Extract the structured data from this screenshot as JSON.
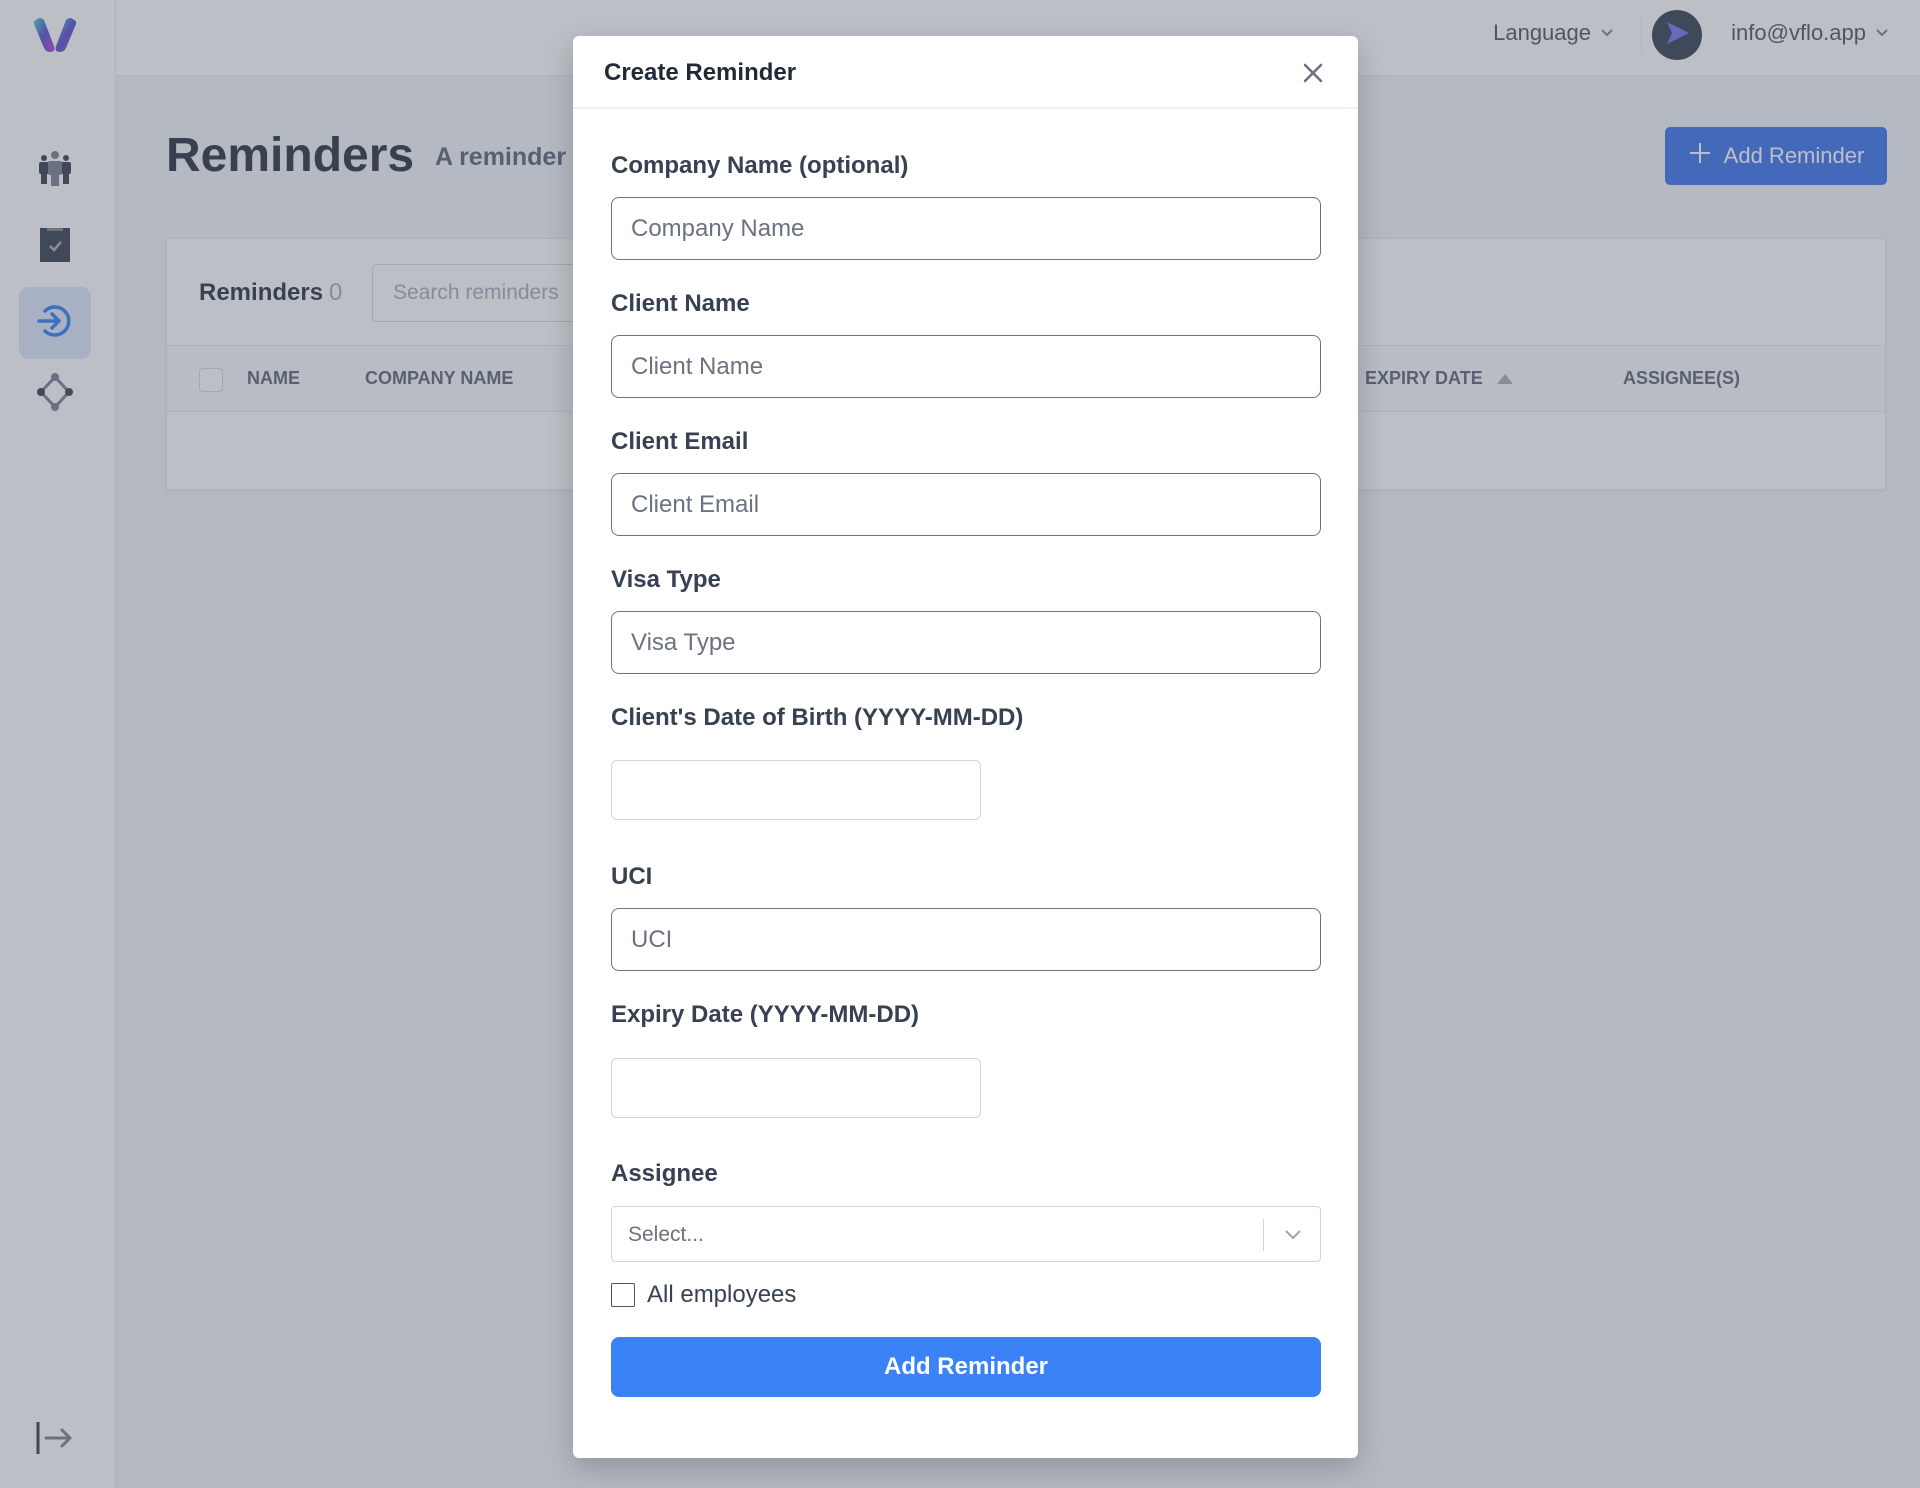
{
  "topbar": {
    "language_label": "Language",
    "user_email": "info@vflo.app"
  },
  "sidebar": {
    "items": [
      {
        "name": "team",
        "icon": "team-icon",
        "active": false
      },
      {
        "name": "tasks",
        "icon": "clipboard-check-icon",
        "active": false
      },
      {
        "name": "reminders",
        "icon": "arrow-circle-icon",
        "active": true
      },
      {
        "name": "workflows",
        "icon": "nodes-icon",
        "active": false
      }
    ],
    "collapse_icon": "collapse-sidebar-icon"
  },
  "page": {
    "title": "Reminders",
    "subtitle": "A reminder",
    "add_button_label": "Add Reminder"
  },
  "table": {
    "title": "Reminders",
    "count": "0",
    "search_placeholder": "Search reminders",
    "columns": [
      {
        "label": "NAME"
      },
      {
        "label": "COMPANY NAME"
      },
      {
        "label": "EXPIRY DATE",
        "sorted": "asc"
      },
      {
        "label": "ASSIGNEE(S)"
      }
    ],
    "rows": []
  },
  "modal": {
    "title": "Create Reminder",
    "fields": {
      "company": {
        "label": "Company Name (optional)",
        "placeholder": "Company Name",
        "value": ""
      },
      "client_name": {
        "label": "Client Name",
        "placeholder": "Client Name",
        "value": ""
      },
      "client_email": {
        "label": "Client Email",
        "placeholder": "Client Email",
        "value": ""
      },
      "visa_type": {
        "label": "Visa Type",
        "placeholder": "Visa Type",
        "value": ""
      },
      "dob": {
        "label": "Client's Date of Birth (YYYY-MM-DD)",
        "value": ""
      },
      "uci": {
        "label": "UCI",
        "placeholder": "UCI",
        "value": ""
      },
      "expiry": {
        "label": "Expiry Date (YYYY-MM-DD)",
        "value": ""
      },
      "assignee": {
        "label": "Assignee",
        "placeholder": "Select..."
      }
    },
    "all_employees_label": "All employees",
    "all_employees_checked": false,
    "submit_label": "Add Reminder"
  },
  "colors": {
    "primary": "#3b82f6",
    "primary_dark": "#2563eb",
    "active_nav_bg": "#dbe6fb"
  }
}
